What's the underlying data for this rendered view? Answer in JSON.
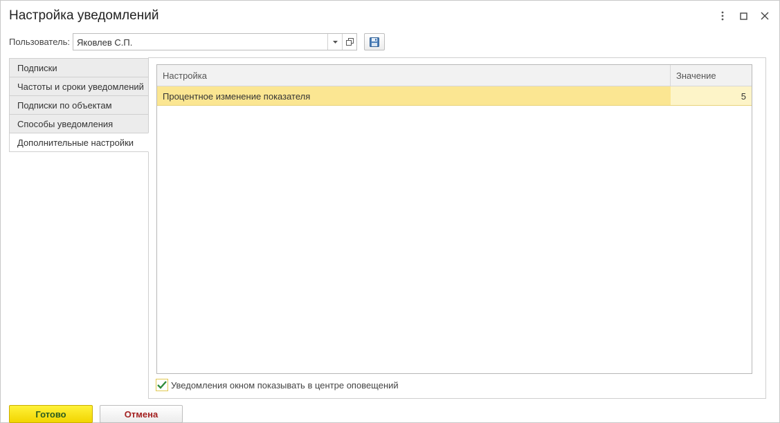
{
  "window": {
    "title": "Настройка уведомлений",
    "controls": [
      "more-icon",
      "maximize-icon",
      "close-icon"
    ]
  },
  "user": {
    "label": "Пользователь:",
    "value": "Яковлев С.П."
  },
  "tabs": [
    {
      "label": "Подписки",
      "active": false
    },
    {
      "label": "Частоты и сроки уведомлений",
      "active": false
    },
    {
      "label": "Подписки по объектам",
      "active": false
    },
    {
      "label": "Способы уведомления",
      "active": false
    },
    {
      "label": "Дополнительные настройки",
      "active": true
    }
  ],
  "grid": {
    "columns": [
      "Настройка",
      "Значение"
    ],
    "rows": [
      {
        "setting": "Процентное изменение показателя",
        "value": "5"
      }
    ]
  },
  "checkbox": {
    "label": "Уведомления окном показывать в центре оповещений",
    "checked": true
  },
  "buttons": {
    "ok": "Готово",
    "cancel": "Отмена"
  },
  "colors": {
    "accent_yellow": "#f2d500",
    "selected_row": "#fbe692",
    "ok_text": "#2b5c1f",
    "cancel_text": "#a32020",
    "check_green": "#2e8b3a"
  }
}
